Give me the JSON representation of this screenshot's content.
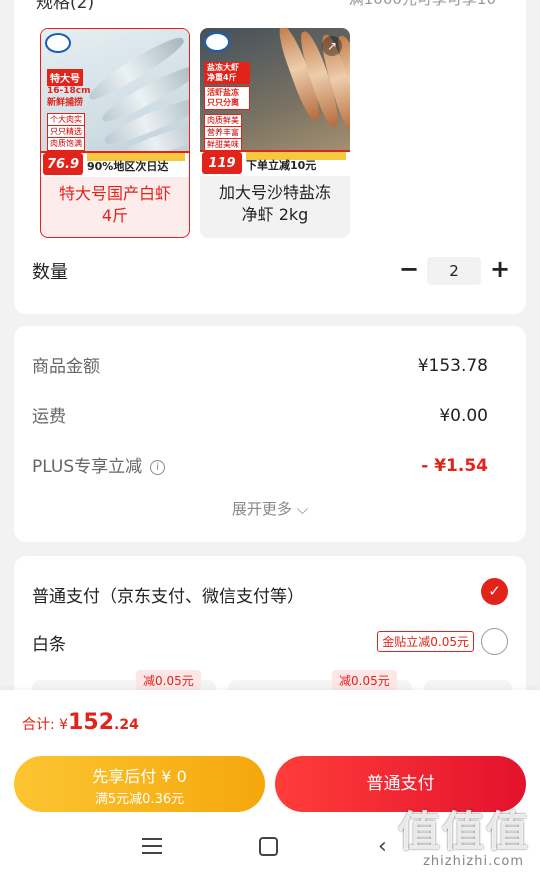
{
  "spec_section": {
    "header": "规格(2)",
    "header_right": "满1000元可享可享10",
    "variants": [
      {
        "label": "特大号国产白虾\n4斤",
        "selected": true,
        "image": {
          "badge": "特大号",
          "size_text": "16-18cm",
          "fresh_text": "新鲜捕捞",
          "tags": [
            "个大肉实",
            "只只精选",
            "肉质饱满"
          ],
          "price": "76.9",
          "banner": "90%地区次日达"
        }
      },
      {
        "label": "加大号沙特盐冻\n净虾 2kg",
        "selected": false,
        "image": {
          "badge": "盐冻大虾 净重4斤",
          "sub": "活虾盐冻 只只分离",
          "tags": [
            "肉质鲜美",
            "营养丰富",
            "鲜甜美味"
          ],
          "price": "119",
          "banner": "下单立减10元"
        }
      }
    ]
  },
  "quantity": {
    "label": "数量",
    "minus": "−",
    "value": "2",
    "plus": "+"
  },
  "summary": {
    "rows": [
      {
        "label": "商品金额",
        "value": "¥153.78"
      },
      {
        "label": "运费",
        "value": "¥0.00"
      },
      {
        "label": "PLUS专享立减",
        "value": "- ¥1.54",
        "info": "i"
      }
    ],
    "expand_more": "展开更多 ⌵"
  },
  "payment": {
    "normal_label": "普通支付（京东支付、微信支付等）",
    "normal_check": "✓",
    "baitiao_label": "白条",
    "baitiao_promo": "金贴立减0.05元",
    "installments": [
      {
        "tag": "减0.05元"
      },
      {
        "tag": "减0.05元"
      }
    ]
  },
  "bottom": {
    "total_prefix": "合计: ",
    "currency": "¥",
    "total_int": "152",
    "total_dec": ".24",
    "btn_later_line1": "先享后付 ¥ 0",
    "btn_later_line2": "满5元减0.36元",
    "btn_pay": "普通支付",
    "watermark": "值值值",
    "watermark_sub": "zhizhizhi.com"
  },
  "colors": {
    "accent_red": "#e2231a",
    "gold": "#f5a70c"
  },
  "icons": [
    "info-icon",
    "check-icon",
    "expand-icon",
    "menu-icon",
    "home-icon",
    "back-icon"
  ]
}
